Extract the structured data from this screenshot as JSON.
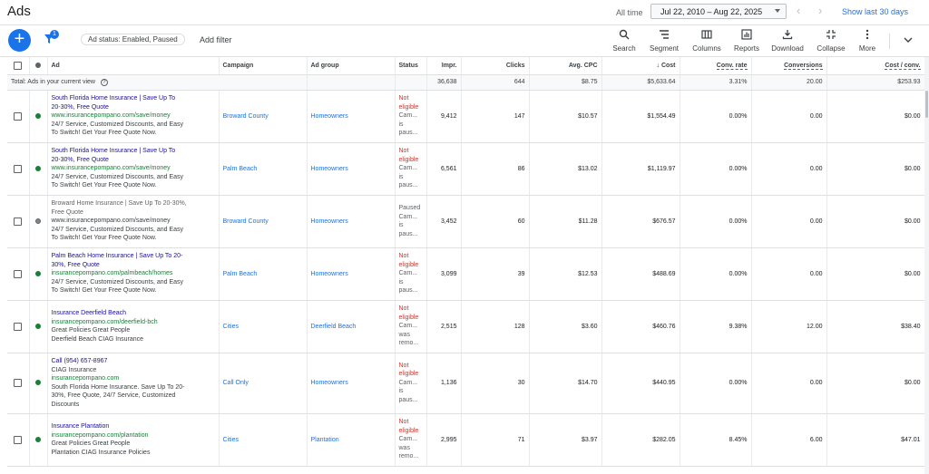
{
  "header": {
    "title": "Ads",
    "all_time_label": "All time",
    "date_range": "Jul 22, 2010 – Aug 22, 2025",
    "show_last": "Show last 30 days"
  },
  "filterbar": {
    "filter_badge": "1",
    "chip": "Ad status: Enabled, Paused",
    "add_filter": "Add filter",
    "tools": [
      "Search",
      "Segment",
      "Columns",
      "Reports",
      "Download",
      "Collapse",
      "More"
    ]
  },
  "table": {
    "headers": {
      "ad": "Ad",
      "campaign": "Campaign",
      "adgroup": "Ad group",
      "status": "Status",
      "impr": "Impr.",
      "clicks": "Clicks",
      "cpc": "Avg. CPC",
      "cost": "Cost",
      "convrate": "Conv. rate",
      "conversions": "Conversions",
      "costconv": "Cost / conv."
    },
    "total": {
      "label": "Total: Ads in your current view",
      "impr": "36,638",
      "clicks": "644",
      "cpc": "$8.75",
      "cost": "$5,633.64",
      "convrate": "3.31%",
      "conversions": "20.00",
      "costconv": "$253.93"
    },
    "rows": [
      {
        "h1": "South Florida Home Insurance | Save Up To",
        "h2": "20-30%, Free Quote",
        "url": "www.insurancepompano.com/save/money",
        "d1": "24/7 Service, Customized Discounts, and Easy",
        "d2": "To Switch! Get Your Free Quote Now.",
        "campaign": "Broward County",
        "adgroup": "Homeowners",
        "st1": "Not",
        "st2": "eligible",
        "st3": "Cam...",
        "st4": "is",
        "st5": "paus...",
        "impr": "9,412",
        "clicks": "147",
        "cpc": "$10.57",
        "cost": "$1,554.49",
        "convrate": "0.00%",
        "conversions": "0.00",
        "costconv": "$0.00"
      },
      {
        "h1": "South Florida Home Insurance | Save Up To",
        "h2": "20-30%, Free Quote",
        "url": "www.insurancepompano.com/save/money",
        "d1": "24/7 Service, Customized Discounts, and Easy",
        "d2": "To Switch! Get Your Free Quote Now.",
        "campaign": "Palm Beach",
        "adgroup": "Homeowners",
        "st1": "Not",
        "st2": "eligible",
        "st3": "Cam...",
        "st4": "is",
        "st5": "paus...",
        "impr": "6,561",
        "clicks": "86",
        "cpc": "$13.02",
        "cost": "$1,119.97",
        "convrate": "0.00%",
        "conversions": "0.00",
        "costconv": "$0.00"
      },
      {
        "h1": "Broward Home Insurance | Save Up To 20-30%,",
        "h2": "Free Quote",
        "url": "www.insurancepompano.com/save/money",
        "d1": "24/7 Service, Customized Discounts, and Easy",
        "d2": "To Switch! Get Your Free Quote Now.",
        "campaign": "Broward County",
        "adgroup": "Homeowners",
        "st1": "Paused",
        "st2": "Cam...",
        "st3": "is",
        "st4": "paus...",
        "st5": "",
        "impr": "3,452",
        "clicks": "60",
        "cpc": "$11.28",
        "cost": "$676.57",
        "convrate": "0.00%",
        "conversions": "0.00",
        "costconv": "$0.00"
      },
      {
        "h1": "Palm Beach Home Insurance | Save Up To 20-",
        "h2": "30%, Free Quote",
        "url": "insurancepompano.com/palmbeach/homes",
        "d1": "24/7 Service, Customized Discounts, and Easy",
        "d2": "To Switch! Get Your Free Quote Now.",
        "campaign": "Palm Beach",
        "adgroup": "Homeowners",
        "st1": "Not",
        "st2": "eligible",
        "st3": "Cam...",
        "st4": "is",
        "st5": "paus...",
        "impr": "3,099",
        "clicks": "39",
        "cpc": "$12.53",
        "cost": "$488.69",
        "convrate": "0.00%",
        "conversions": "0.00",
        "costconv": "$0.00"
      },
      {
        "h1": "Insurance Deerfield Beach",
        "h2": "",
        "url": "insurancepompano.com/deerfield-bch",
        "d1": "Great Policies Great People",
        "d2": "Deerfield Beach CIAG Insurance",
        "campaign": "Cities",
        "adgroup": "Deerfield Beach",
        "st1": "Not",
        "st2": "eligible",
        "st3": "Cam...",
        "st4": "was",
        "st5": "remo...",
        "impr": "2,515",
        "clicks": "128",
        "cpc": "$3.60",
        "cost": "$460.76",
        "convrate": "9.38%",
        "conversions": "12.00",
        "costconv": "$38.40"
      },
      {
        "h1": "Call (954) 657-8967",
        "h2": "CIAG Insurance",
        "url": "insurancepompano.com",
        "d1": "South Florida Home Insurance. Save Up To 20-",
        "d2": "30%, Free Quote, 24/7 Service, Customized",
        "d3": "Discounts",
        "campaign": "Call Only",
        "adgroup": "Homeowners",
        "st1": "Not",
        "st2": "eligible",
        "st3": "Cam...",
        "st4": "is",
        "st5": "paus...",
        "impr": "1,136",
        "clicks": "30",
        "cpc": "$14.70",
        "cost": "$440.95",
        "convrate": "0.00%",
        "conversions": "0.00",
        "costconv": "$0.00"
      },
      {
        "h1": "Insurance Plantation",
        "h2": "",
        "url": "insurancepompano.com/plantation",
        "d1": "Great Policies Great People",
        "d2": "Plantation CIAG Insurance Policies",
        "campaign": "Cities",
        "adgroup": "Plantation",
        "st1": "Not",
        "st2": "eligible",
        "st3": "Cam...",
        "st4": "was",
        "st5": "remo...",
        "impr": "2,995",
        "clicks": "71",
        "cpc": "$3.97",
        "cost": "$282.05",
        "convrate": "8.45%",
        "conversions": "6.00",
        "costconv": "$47.01"
      }
    ]
  },
  "colors": {
    "accent": "#1a73e8",
    "enabled": "#188038",
    "not_eligible": "#d93025",
    "headline": "#1a0dab"
  }
}
